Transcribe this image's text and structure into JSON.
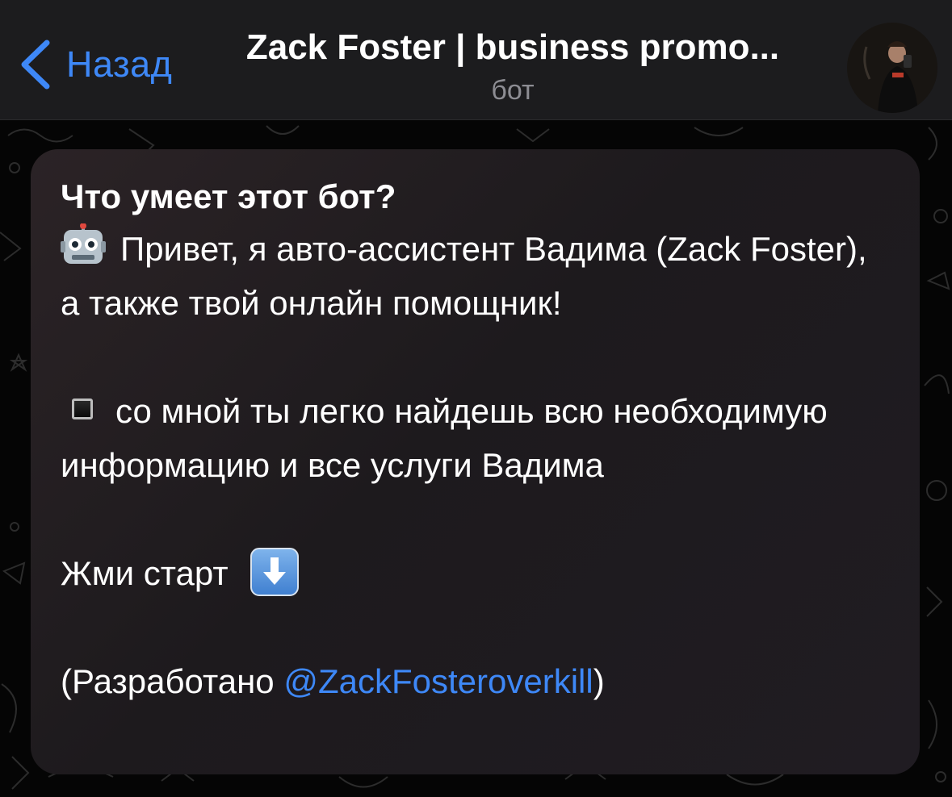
{
  "header": {
    "back_label": "Назад",
    "title": "Zack Foster | business promo...",
    "subtitle": "бот"
  },
  "info_card": {
    "heading": "Что умеет этот бот?",
    "intro_line": "Привет, я авто-ассистент Вадима (Zack Foster), а также твой онлайн помощник!",
    "feature_line": "со мной ты легко найдешь всю необходимую информацию и все услуги Вадима",
    "cta_text": "Жми старт",
    "credit_prefix": "(Разработано ",
    "credit_mention": "@ZackFosteroverkill",
    "credit_suffix": ")"
  },
  "icons": {
    "back": "chevron-left-icon",
    "intro_emoji": "robot-icon",
    "feature_emoji": "black-square-icon",
    "cta_emoji": "arrow-down-icon"
  },
  "colors": {
    "accent": "#3e88f7",
    "header_bg": "#1c1c1e",
    "subtitle": "#8d8d93",
    "text": "#ffffff"
  }
}
